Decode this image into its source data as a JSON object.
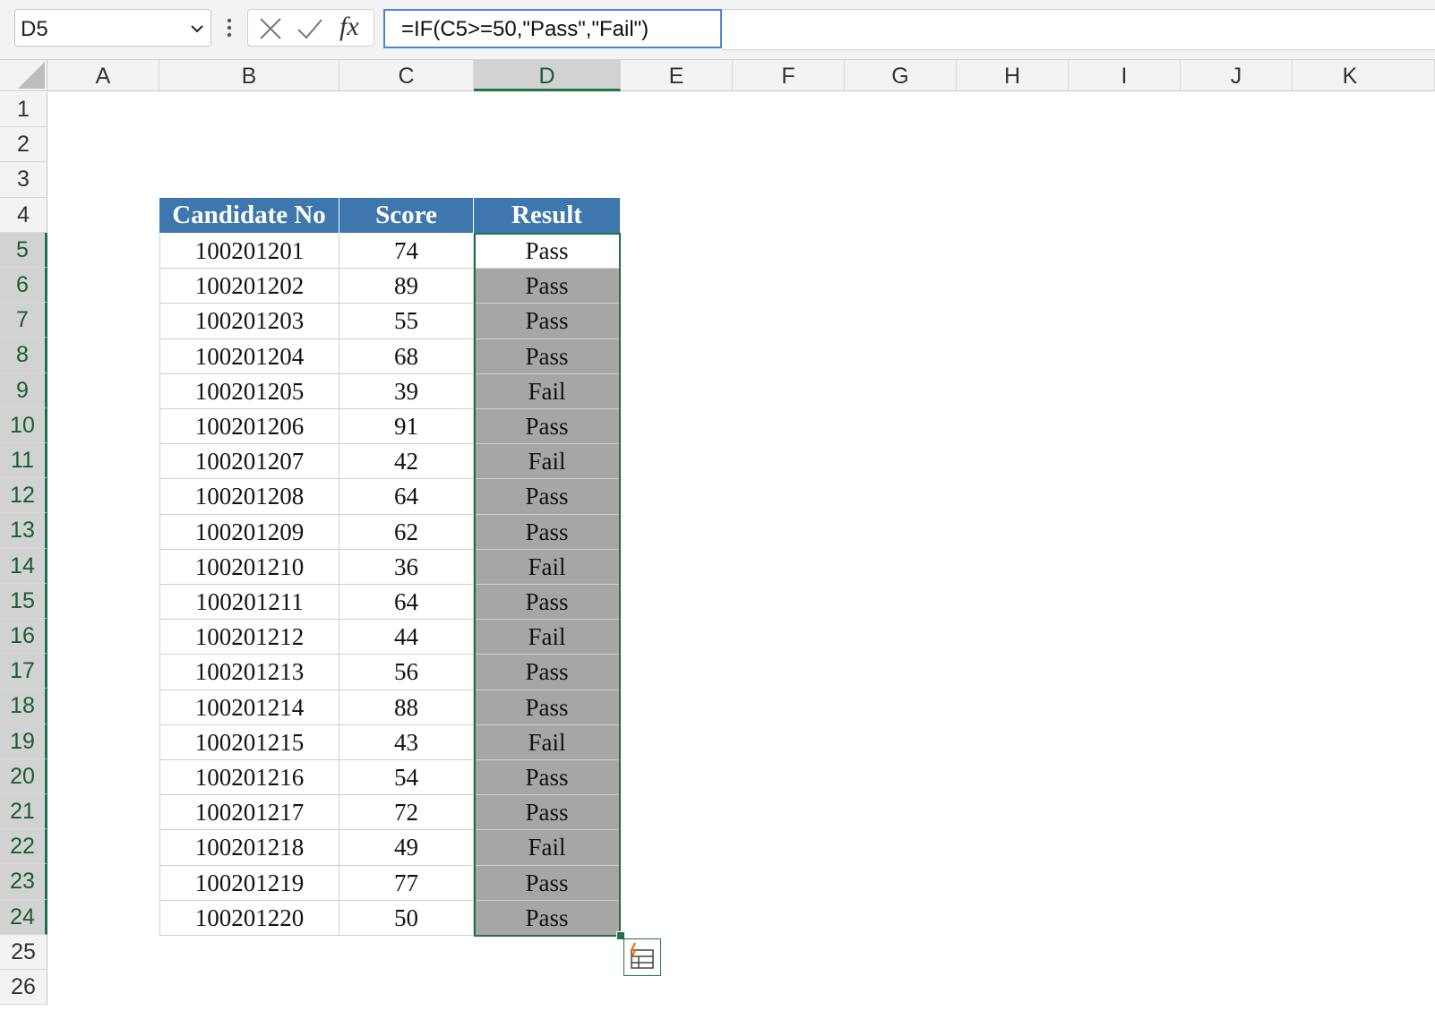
{
  "formula_bar": {
    "name_box": "D5",
    "fx_label": "fx",
    "formula": "=IF(C5>=50,\"Pass\",\"Fail\")"
  },
  "columns": [
    "A",
    "B",
    "C",
    "D",
    "E",
    "F",
    "G",
    "H",
    "I",
    "J",
    "K"
  ],
  "rows": [
    "1",
    "2",
    "3",
    "4",
    "5",
    "6",
    "7",
    "8",
    "9",
    "10",
    "11",
    "12",
    "13",
    "14",
    "15",
    "16",
    "17",
    "18",
    "19",
    "20",
    "21",
    "22",
    "23",
    "24",
    "25",
    "26"
  ],
  "table": {
    "headers": [
      "Candidate No",
      "Score",
      "Result"
    ],
    "rows": [
      [
        "100201201",
        "74",
        "Pass"
      ],
      [
        "100201202",
        "89",
        "Pass"
      ],
      [
        "100201203",
        "55",
        "Pass"
      ],
      [
        "100201204",
        "68",
        "Pass"
      ],
      [
        "100201205",
        "39",
        "Fail"
      ],
      [
        "100201206",
        "91",
        "Pass"
      ],
      [
        "100201207",
        "42",
        "Fail"
      ],
      [
        "100201208",
        "64",
        "Pass"
      ],
      [
        "100201209",
        "62",
        "Pass"
      ],
      [
        "100201210",
        "36",
        "Fail"
      ],
      [
        "100201211",
        "64",
        "Pass"
      ],
      [
        "100201212",
        "44",
        "Fail"
      ],
      [
        "100201213",
        "56",
        "Pass"
      ],
      [
        "100201214",
        "88",
        "Pass"
      ],
      [
        "100201215",
        "43",
        "Fail"
      ],
      [
        "100201216",
        "54",
        "Pass"
      ],
      [
        "100201217",
        "72",
        "Pass"
      ],
      [
        "100201218",
        "49",
        "Fail"
      ],
      [
        "100201219",
        "77",
        "Pass"
      ],
      [
        "100201220",
        "50",
        "Pass"
      ]
    ]
  },
  "selection": {
    "active_cell": "D5",
    "range": "D5:D24"
  },
  "colors": {
    "header_fill": "#3e77ae",
    "selection": "#217346",
    "selected_fill": "#a6a6a6"
  },
  "icons": [
    "chevron-down-icon",
    "more-options-icon",
    "cancel-icon",
    "enter-icon",
    "insert-function-icon",
    "select-all-icon",
    "quick-analysis-icon"
  ]
}
